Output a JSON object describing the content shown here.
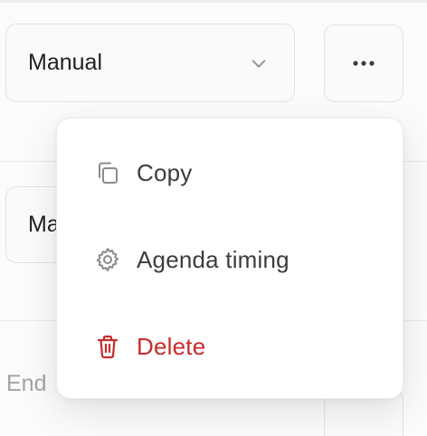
{
  "top_row": {
    "mode_select": {
      "value": "Manual"
    },
    "more_button_label": "•••"
  },
  "second_row": {
    "mode_select": {
      "value": "Ma"
    }
  },
  "bottom_row": {
    "label": "End"
  },
  "context_menu": {
    "items": [
      {
        "label": "Copy",
        "icon": "copy-icon"
      },
      {
        "label": "Agenda timing",
        "icon": "gear-icon"
      },
      {
        "label": "Delete",
        "icon": "trash-icon",
        "color": "#cc2a2a"
      }
    ]
  },
  "colors": {
    "danger": "#cc2a2a",
    "text": "#1f1f22",
    "muted": "#a2a2a6",
    "border": "#e3e3e5"
  }
}
